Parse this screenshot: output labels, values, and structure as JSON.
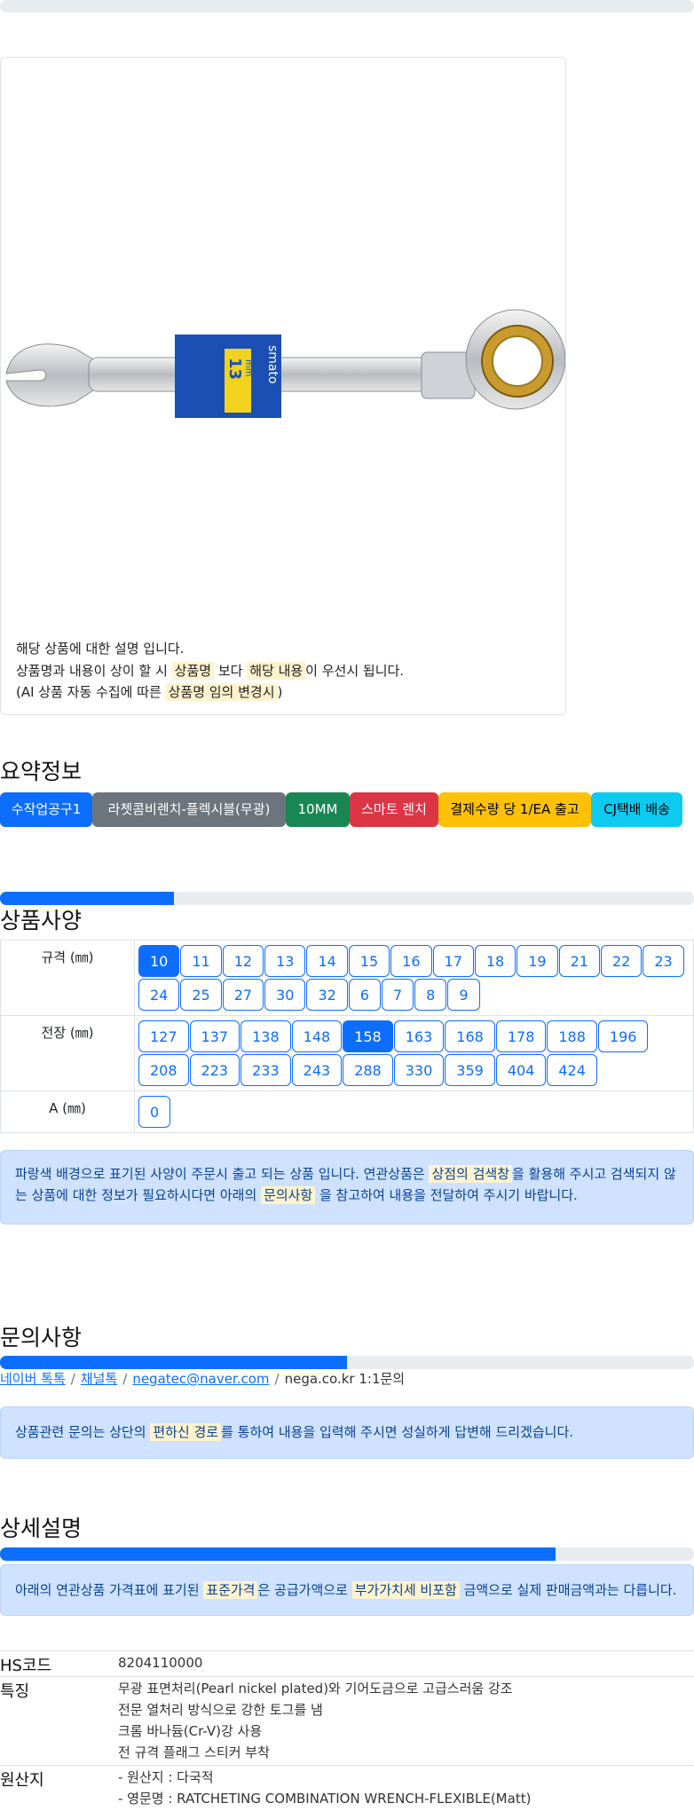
{
  "card": {
    "line1": "해당 상품에 대한 설명 입니다.",
    "line2_pre": "상품명과 내용이 상이 할 시 ",
    "line2_hl1": "상품명",
    "line2_mid": " 보다 ",
    "line2_hl2": "해당 내용",
    "line2_post": "이 우선시 됩니다.",
    "line3_pre": "(AI 상품 자동 수집에 따른 ",
    "line3_hl": "상품명 임의 변경시",
    "line3_post": ")",
    "label_brand": "smato",
    "label_size_num": "13",
    "label_size_unit": "mm"
  },
  "summary": {
    "title": "요약정보",
    "chips": [
      "수작업공구1",
      "라쳇콤비렌치-플렉시블(무광)",
      "10MM",
      "스마토 렌치",
      "결제수량 당 1/EA 출고",
      "CJ택배 배송"
    ]
  },
  "spec": {
    "title": "상품사양",
    "progress": 0.25,
    "rows": [
      {
        "label": "규격 (㎜)",
        "options": [
          "10",
          "11",
          "12",
          "13",
          "14",
          "15",
          "16",
          "17",
          "18",
          "19",
          "21",
          "22",
          "23",
          "24",
          "25",
          "27",
          "30",
          "32",
          "6",
          "7",
          "8",
          "9"
        ],
        "selected": "10"
      },
      {
        "label": "전장 (㎜)",
        "options": [
          "127",
          "137",
          "138",
          "148",
          "158",
          "163",
          "168",
          "178",
          "188",
          "196",
          "208",
          "223",
          "233",
          "243",
          "288",
          "330",
          "359",
          "404",
          "424"
        ],
        "selected": "158"
      },
      {
        "label": "A (㎜)",
        "options": [
          "0"
        ],
        "selected": ""
      }
    ],
    "notice_pre": "파랑색 배경으로 표기된 사양이 주문시 출고 되는 상품 입니다. 연관상품은 ",
    "notice_hl1": "상점의 검색창",
    "notice_mid": "을 활용해 주시고 검색되지 않는 상품에 대한 정보가 필요하시다면 아래의 ",
    "notice_hl2": "문의사항",
    "notice_post": " 을 참고하여 내용을 전달하여 주시기 바랍니다."
  },
  "inquiry": {
    "title": "문의사항",
    "progress": 0.5,
    "links": [
      "네이버 톡톡",
      "채널톡",
      "negatec@naver.com"
    ],
    "current": "nega.co.kr 1:1문의",
    "notice_pre": "상품관련 문의는 상단의 ",
    "notice_hl": "편하신 경로",
    "notice_post": "를 통하여 내용을 입력해 주시면 성실하게 답변해 드리겠습니다."
  },
  "detail": {
    "title": "상세설명",
    "progress": 0.8,
    "notice_pre": "아래의 연관상품 가격표에 표기된 ",
    "notice_hl1": "표준가격",
    "notice_mid": "은 공급가액으로 ",
    "notice_hl2": "부가가치세 비포함",
    "notice_post": " 금액으로 실제 판매금액과는 다릅니다.",
    "rows": [
      {
        "key": "HS코드",
        "values": [
          "8204110000"
        ]
      },
      {
        "key": "특징",
        "values": [
          "무광 표면처리(Pearl nickel plated)와 기어도금으로 고급스러움 강조",
          "전문 열처리 방식으로 강한 토그를 냄",
          "크롬 바나듐(Cr-V)강 사용",
          "전 규격 플래그 스티커 부착"
        ]
      },
      {
        "key": "원산지",
        "values": [
          "- 원산지 : 다국적",
          "- 영문명 : RATCHETING COMBINATION WRENCH-FLEXIBLE(Matt)"
        ]
      }
    ]
  }
}
